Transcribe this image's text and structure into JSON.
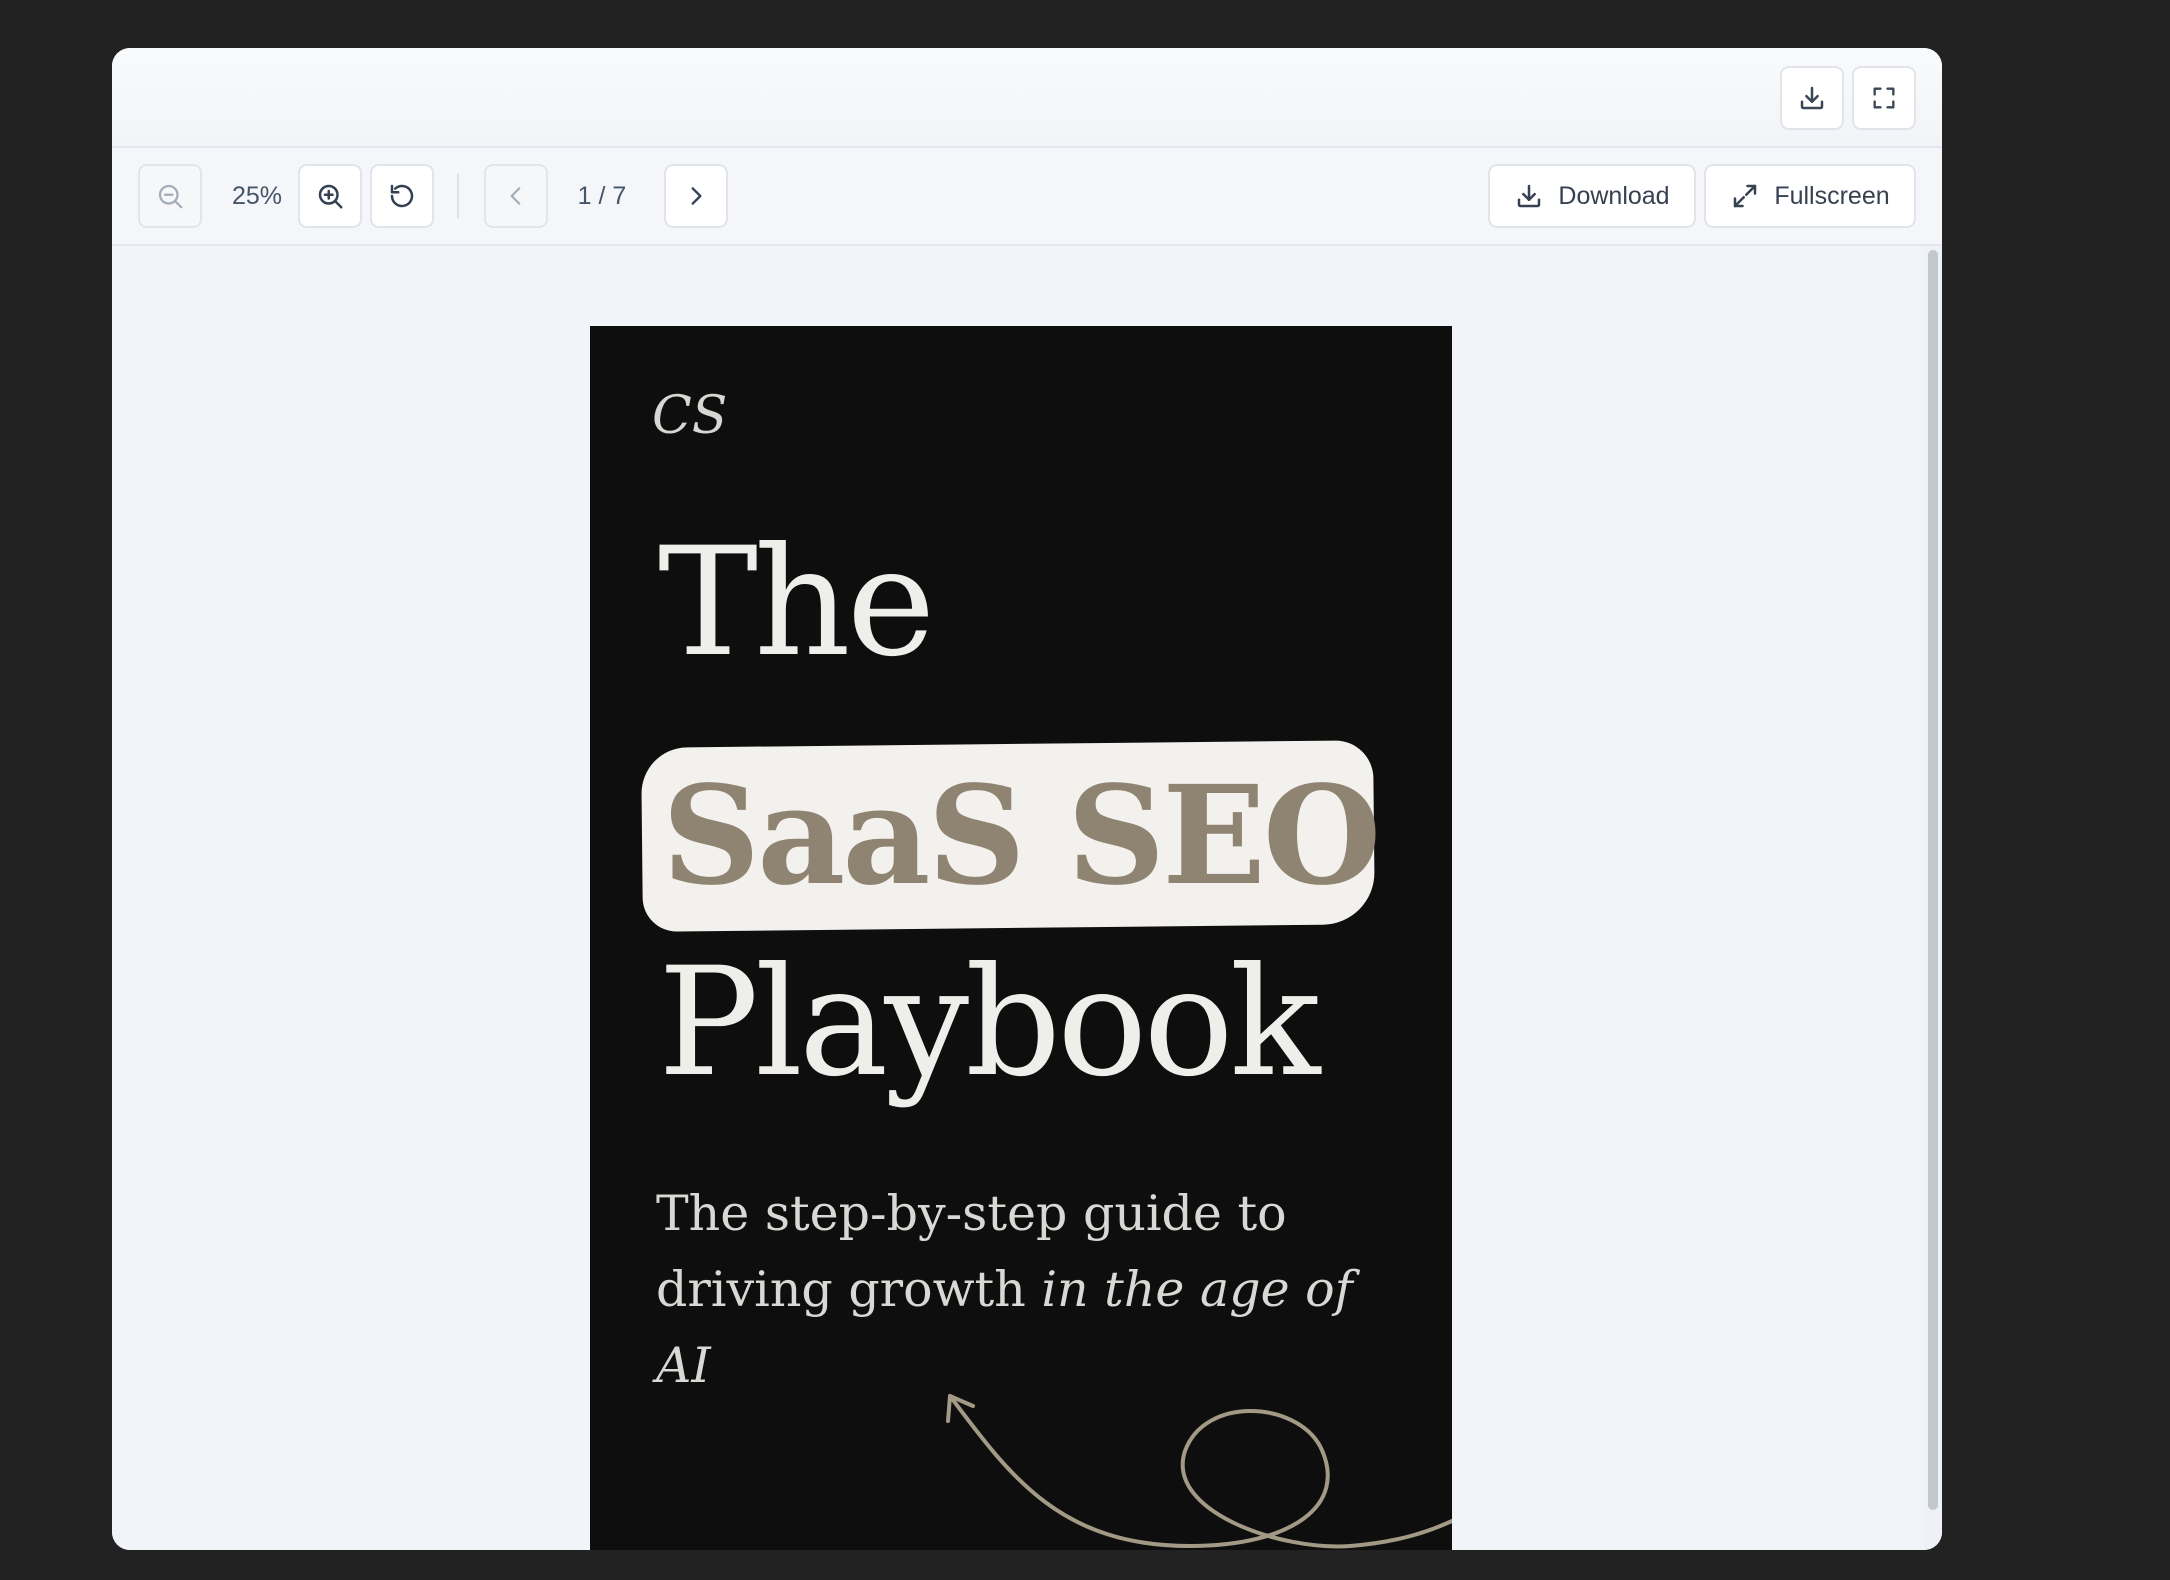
{
  "header": {
    "download_icon": "download-icon",
    "fullscreen_icon": "fullscreen-icon"
  },
  "toolbar": {
    "zoom_level": "25%",
    "page_indicator": "1 / 7",
    "download_label": "Download",
    "fullscreen_label": "Fullscreen"
  },
  "document": {
    "monogram": "CS",
    "title_line1": "The",
    "title_highlight": "SaaS SEO",
    "title_line3": "Playbook",
    "subtitle_line1": "The step-by-step guide to",
    "subtitle_line2_plain": "driving growth ",
    "subtitle_line2_italic": "in the age of AI",
    "accent_color": "#8e8471"
  }
}
